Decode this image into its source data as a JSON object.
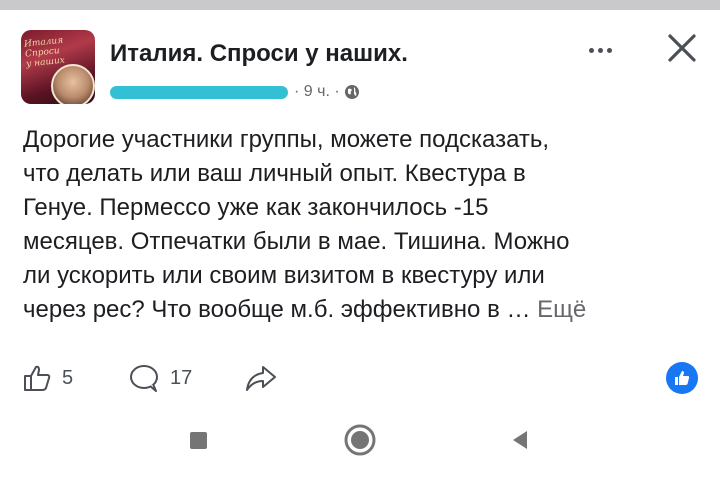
{
  "post": {
    "group_name": "Италия. Спроси у наших.",
    "avatar_text": "Италия. Спроси у наших",
    "time": "· 9 ч. ·",
    "body_lines": [
      "Дорогие участники группы, можете подсказать,",
      "что делать или ваш личный опыт. Квестура в",
      "Генуе. Пермессо уже как закончилось -15",
      "месяцев. Отпечатки были в мае. Тишина. Можно",
      "ли ускорить или своим визитом в квестуру или",
      "через рес? Что вообще м.б. эффективно в … "
    ],
    "see_more": "Ещё"
  },
  "actions": {
    "likes": "5",
    "comments": "17"
  },
  "icons": {
    "globe": "globe-icon",
    "more": "more-options-icon",
    "close": "close-icon",
    "like": "thumbs-up-icon",
    "comment": "comment-bubble-icon",
    "share": "share-arrow-icon",
    "like_badge": "like-reaction-icon",
    "nav_recent": "square-icon",
    "nav_home": "circle-icon",
    "nav_back": "triangle-back-icon"
  },
  "colors": {
    "accent": "#1877f2",
    "redaction": "#33c0d4",
    "muted": "#65676b"
  }
}
